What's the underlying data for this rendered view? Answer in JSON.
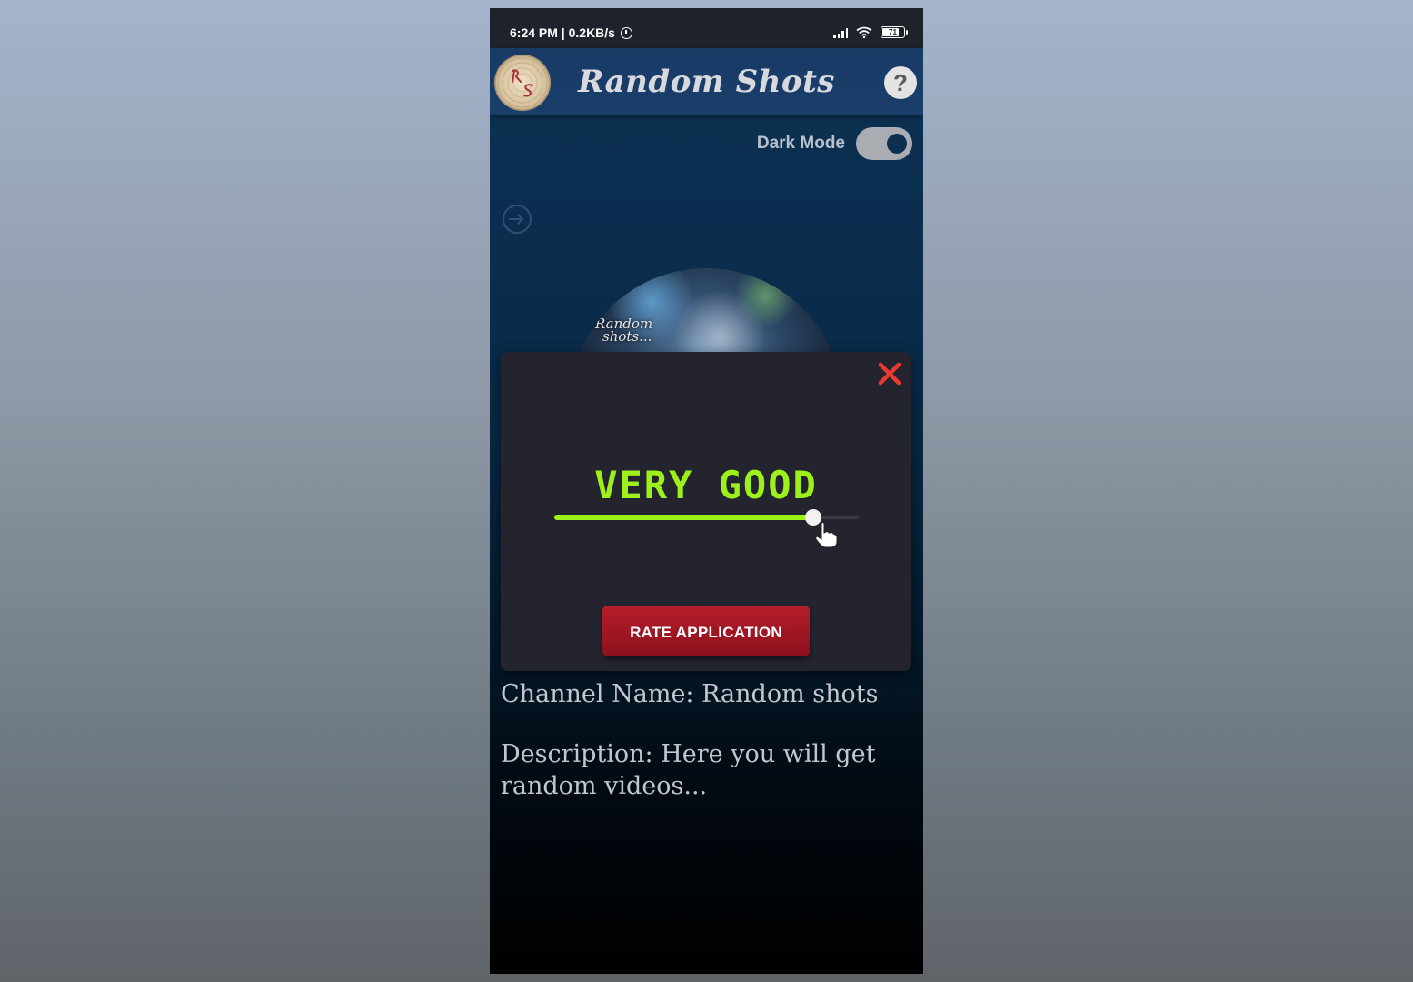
{
  "status_bar": {
    "time_network": "6:24 PM | 0.2KB/s",
    "battery": "71"
  },
  "app_bar": {
    "title": "Random Shots",
    "help": "?"
  },
  "dark_mode": {
    "label": "Dark Mode",
    "enabled": true
  },
  "avatar": {
    "watermark_line1": "Random",
    "watermark_line2": "shots..."
  },
  "rating_dialog": {
    "rating_label": "VERY GOOD",
    "rating_fraction": 0.85,
    "rate_button_label": "RATE APPLICATION",
    "accent_color": "#9ef01a",
    "close_color": "#ea3b32"
  },
  "channel": {
    "name_line": "Channel Name: Random shots",
    "description_line": "Description: Here you will get random videos..."
  },
  "icons": [
    "alarm-icon",
    "signal-icon",
    "wifi-icon",
    "battery-icon",
    "app-logo",
    "help-icon",
    "logout-icon",
    "close-icon",
    "hand-cursor-icon"
  ]
}
